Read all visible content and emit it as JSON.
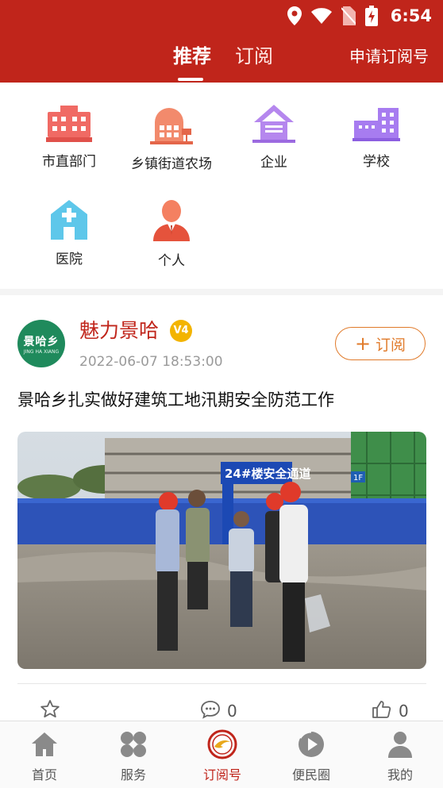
{
  "status_bar": {
    "time": "6:54"
  },
  "header": {
    "tabs": [
      {
        "label": "推荐",
        "active": true
      },
      {
        "label": "订阅",
        "active": false
      }
    ],
    "apply_label": "申请订阅号",
    "brand_color": "#c0251b"
  },
  "categories": [
    {
      "label": "市直部门",
      "icon": "government-building-icon"
    },
    {
      "label": "乡镇街道农场",
      "icon": "town-hall-icon"
    },
    {
      "label": "企业",
      "icon": "enterprise-icon"
    },
    {
      "label": "学校",
      "icon": "school-icon"
    },
    {
      "label": "医院",
      "icon": "hospital-icon"
    },
    {
      "label": "个人",
      "icon": "person-icon"
    }
  ],
  "post": {
    "avatar_text": "景哈乡",
    "avatar_subtext": "JING HA XIANG",
    "author": "魅力景哈",
    "level_badge": "V4",
    "time": "2022-06-07 18:53:00",
    "subscribe_label": "订阅",
    "title": "景哈乡扎实做好建筑工地汛期安全防范工作",
    "photo_sign_text": "24#楼安全通道",
    "photo_floor_label": "1F",
    "comment_count": "0",
    "like_count": "0"
  },
  "bottom_nav": [
    {
      "label": "首页",
      "icon": "home-icon",
      "active": false
    },
    {
      "label": "服务",
      "icon": "services-icon",
      "active": false
    },
    {
      "label": "订阅号",
      "icon": "subscription-icon",
      "active": true
    },
    {
      "label": "便民圈",
      "icon": "community-play-icon",
      "active": false
    },
    {
      "label": "我的",
      "icon": "profile-icon",
      "active": false
    }
  ]
}
